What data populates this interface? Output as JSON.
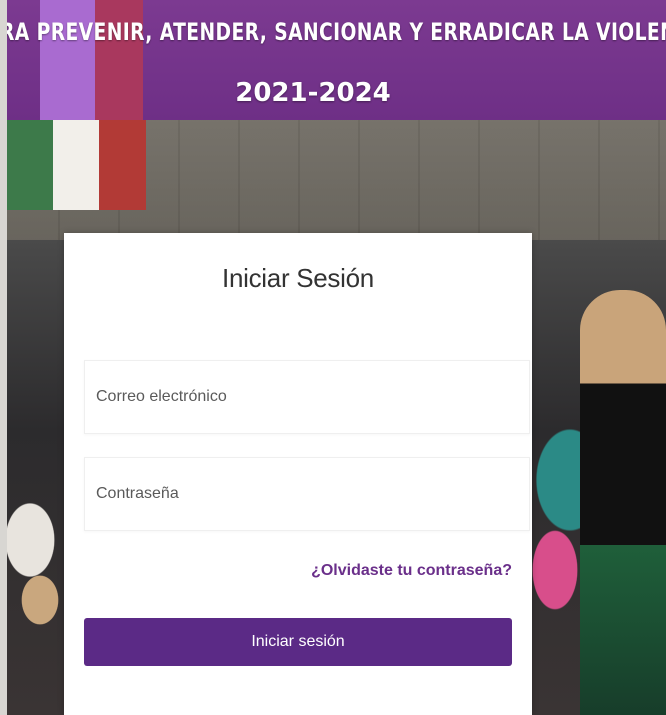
{
  "banner": {
    "title": "RA PREVENIR, ATENDER, SANCIONAR Y ERRADICAR LA VIOLENCIA C",
    "years": "2021-2024"
  },
  "login": {
    "title": "Iniciar Sesión",
    "email_placeholder": "Correo electrónico",
    "password_placeholder": "Contraseña",
    "forgot_label": "¿Olvidaste tu contraseña?",
    "submit_label": "Iniciar sesión"
  },
  "colors": {
    "accent": "#5b2a86",
    "banner": "#6e2f86",
    "link": "#6a2f8a"
  }
}
